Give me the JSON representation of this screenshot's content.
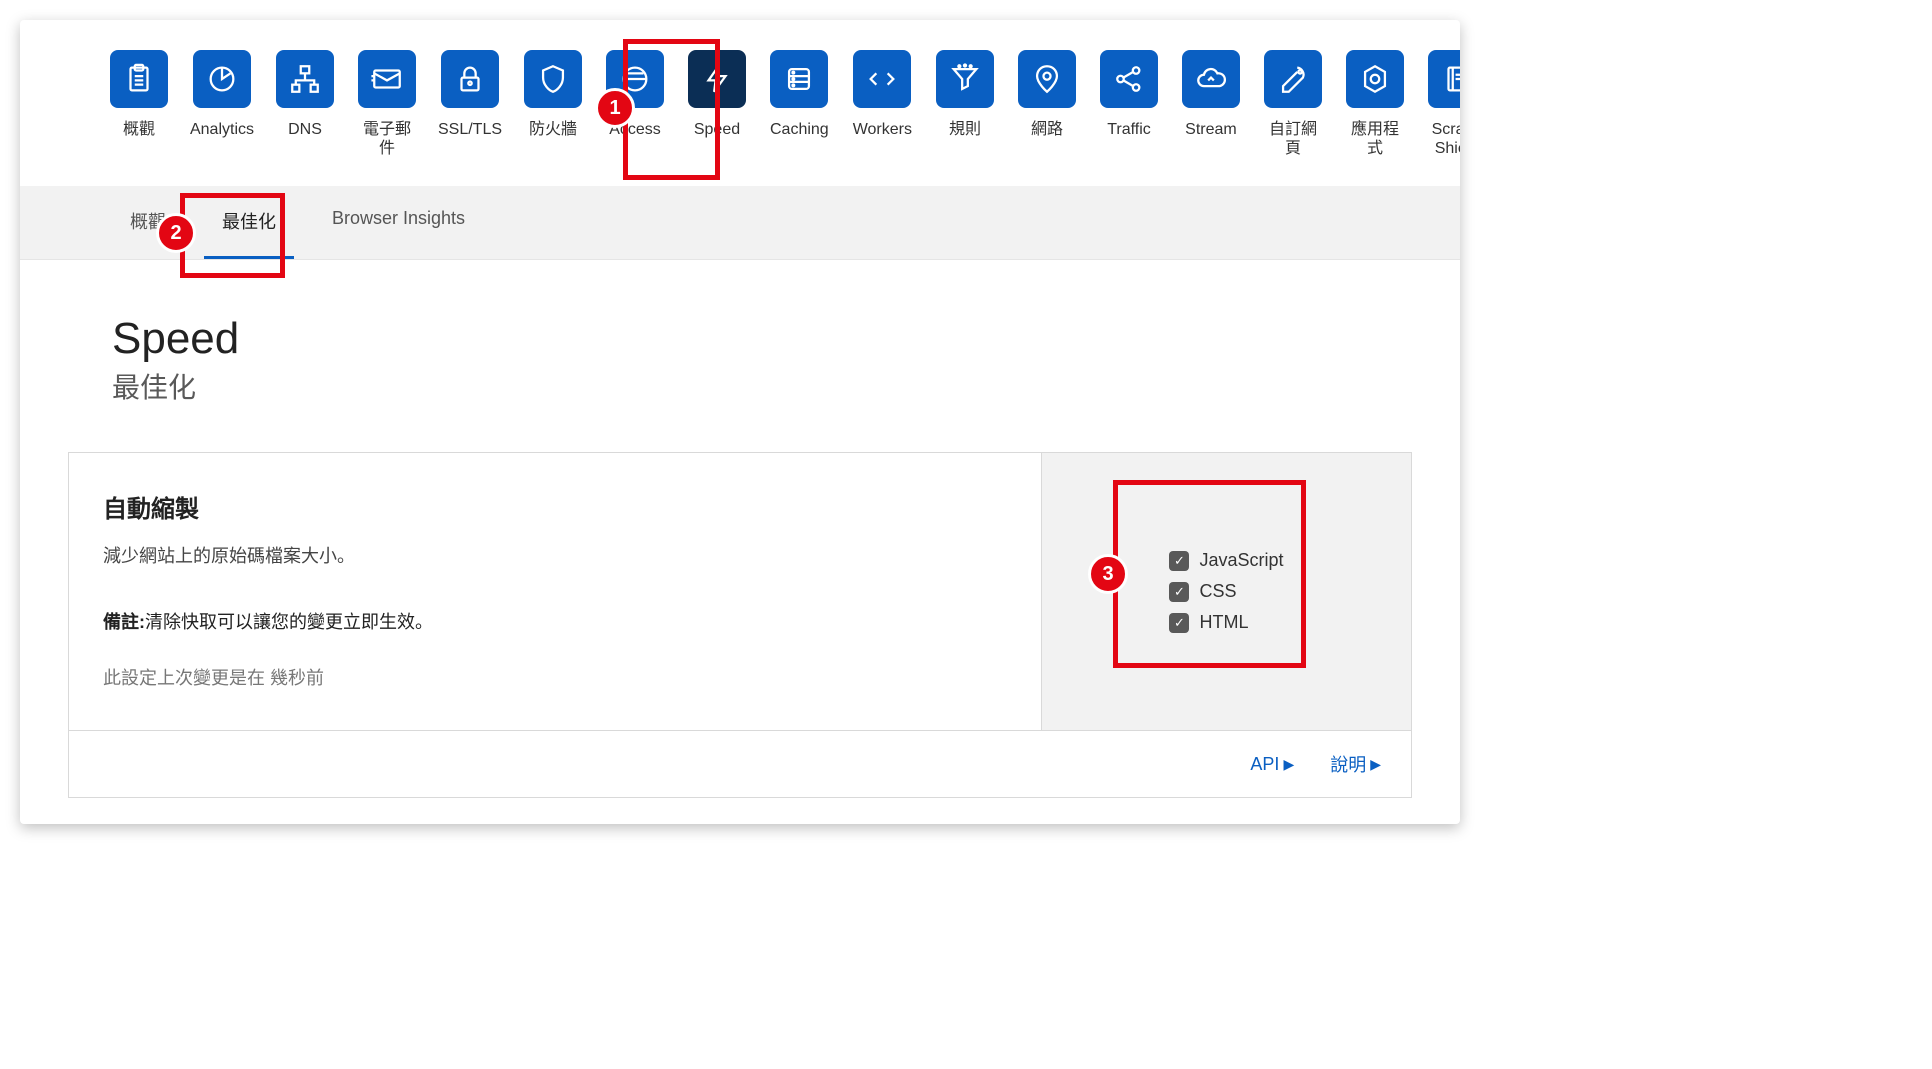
{
  "nav": [
    {
      "id": "overview",
      "label": "概觀",
      "icon": "clipboard"
    },
    {
      "id": "analytics",
      "label": "Analytics",
      "icon": "pie"
    },
    {
      "id": "dns",
      "label": "DNS",
      "icon": "sitemap"
    },
    {
      "id": "email",
      "label": "電子郵件",
      "icon": "envelope"
    },
    {
      "id": "ssl",
      "label": "SSL/TLS",
      "icon": "lock"
    },
    {
      "id": "firewall",
      "label": "防火牆",
      "icon": "shield"
    },
    {
      "id": "access",
      "label": "Access",
      "icon": "access"
    },
    {
      "id": "speed",
      "label": "Speed",
      "icon": "bolt",
      "active": true
    },
    {
      "id": "caching",
      "label": "Caching",
      "icon": "database"
    },
    {
      "id": "workers",
      "label": "Workers",
      "icon": "code"
    },
    {
      "id": "rules",
      "label": "規則",
      "icon": "funnel"
    },
    {
      "id": "network",
      "label": "網路",
      "icon": "pin"
    },
    {
      "id": "traffic",
      "label": "Traffic",
      "icon": "share"
    },
    {
      "id": "stream",
      "label": "Stream",
      "icon": "cloud"
    },
    {
      "id": "custompages",
      "label": "自訂網頁",
      "icon": "wrench"
    },
    {
      "id": "apps",
      "label": "應用程式",
      "icon": "hex-gear"
    },
    {
      "id": "scrapeshield",
      "label": "Scrape Shield",
      "icon": "notebook"
    }
  ],
  "tabs": [
    {
      "id": "overview",
      "label": "概觀"
    },
    {
      "id": "optimize",
      "label": "最佳化",
      "active": true
    },
    {
      "id": "browser-insights",
      "label": "Browser Insights"
    }
  ],
  "heading": {
    "title": "Speed",
    "subtitle": "最佳化"
  },
  "card": {
    "title": "自動縮製",
    "description": "減少網站上的原始碼檔案大小。",
    "note_label": "備註:",
    "note_text": "清除快取可以讓您的變更立即生效。",
    "timestamp": "此設定上次變更是在 幾秒前",
    "options": [
      {
        "id": "js",
        "label": "JavaScript",
        "checked": true
      },
      {
        "id": "css",
        "label": "CSS",
        "checked": true
      },
      {
        "id": "html",
        "label": "HTML",
        "checked": true
      }
    ],
    "footer": {
      "api": "API",
      "help": "說明"
    }
  },
  "annotations": {
    "1": "1",
    "2": "2",
    "3": "3"
  }
}
